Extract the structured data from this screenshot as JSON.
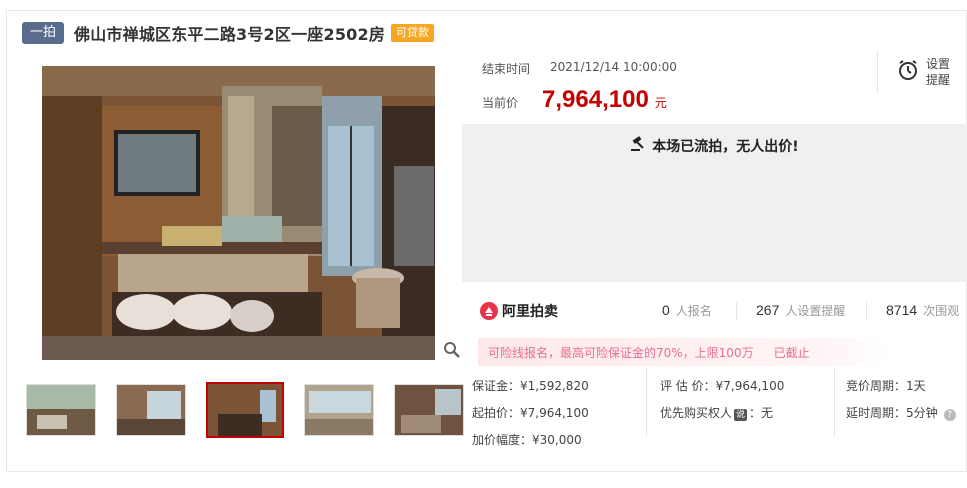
{
  "title": {
    "round_badge": "一拍",
    "text": "佛山市禅城区东平二路3号2区一座2502房",
    "loan_badge": "可贷款"
  },
  "auction": {
    "end_label": "结束时间",
    "end_time": "2021/12/14 10:00:00",
    "price_label": "当前价",
    "price_value": "7,964,100",
    "price_unit": "元",
    "remind_label": "设置提醒",
    "status_text": "本场已流拍，无人出价!"
  },
  "platform": {
    "name": "阿里拍卖",
    "stats": [
      {
        "num": "0",
        "label": "人报名"
      },
      {
        "num": "267",
        "label": "人设置提醒"
      },
      {
        "num": "8714",
        "label": "次围观"
      }
    ]
  },
  "notice": {
    "text": "可险线报名，最高可险保证金的70%，上限100万",
    "status": "已截止"
  },
  "details": {
    "deposit": "保证金：¥1,592,820",
    "start_price": "起拍价：¥7,964,100",
    "increment": "加价幅度：¥30,000",
    "appraisal": "评 估 价：¥7,964,100",
    "priority_prefix": "优先购买权人",
    "priority_badge": "说",
    "priority_suffix": "：无",
    "cycle": "竞价周期：1天",
    "delay": "延时周期：5分钟"
  },
  "colors": {
    "price": "#c40000",
    "round_badge": "#5a6c8e",
    "loan_badge": "#f5a623",
    "notice_text": "#e8708a",
    "thumb_active_border": "#c40000"
  },
  "icons": {
    "zoom": "magnifier-icon",
    "remind": "alarm-clock-icon",
    "status": "gavel-icon",
    "platform": "alibaba-auction-logo",
    "help": "question-icon"
  }
}
